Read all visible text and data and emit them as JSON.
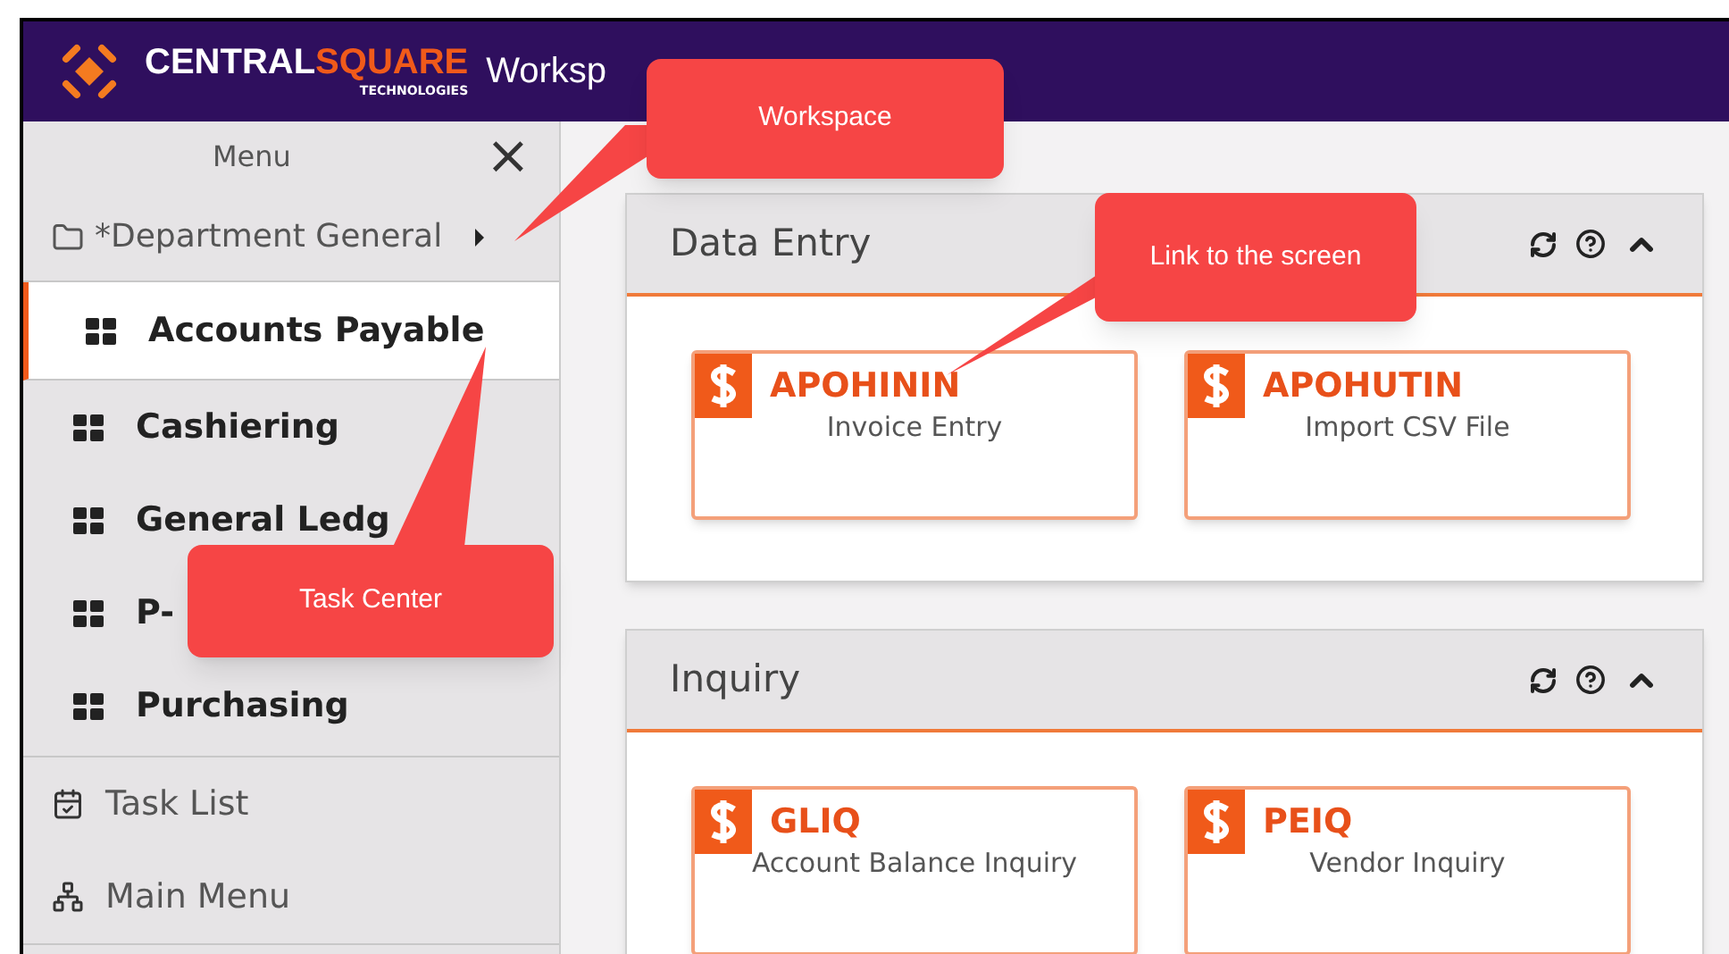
{
  "header": {
    "logo": {
      "word_1": "CENTRAL",
      "word_2": "SQUARE",
      "tagline": "TECHNOLOGIES"
    },
    "title": "Worksp"
  },
  "sidebar": {
    "title": "Menu",
    "close": "×",
    "folder": "*Department General",
    "task_centers": [
      {
        "label": "Accounts Payable",
        "selected": true
      },
      {
        "label": "Cashiering",
        "selected": false
      },
      {
        "label": "General Ledg",
        "selected": false
      },
      {
        "label": "P-",
        "selected": false
      },
      {
        "label": "Purchasing",
        "selected": false
      }
    ],
    "links": [
      {
        "label": "Task List",
        "kind": "tasks"
      },
      {
        "label": "Main Menu",
        "kind": "hierarchy"
      }
    ]
  },
  "panels": [
    {
      "title": "Data Entry",
      "cards": [
        {
          "code": "APOHININ",
          "label": "Invoice Entry"
        },
        {
          "code": "APOHUTIN",
          "label": "Import CSV File"
        }
      ]
    },
    {
      "title": "Inquiry",
      "cards": [
        {
          "code": "GLIQ",
          "label": "Account Balance Inquiry"
        },
        {
          "code": "PEIQ",
          "label": "Vendor Inquiry"
        }
      ]
    }
  ],
  "callouts": [
    {
      "text": "Workspace",
      "kind": "workspace"
    },
    {
      "text": "Link to the screen",
      "kind": "link"
    },
    {
      "text": "Task Center",
      "kind": "task_center"
    }
  ]
}
